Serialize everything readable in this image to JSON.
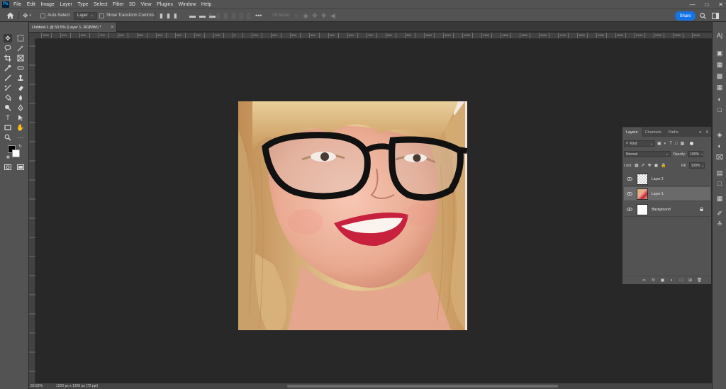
{
  "app": {
    "logo_text": "Ps"
  },
  "menu": [
    "File",
    "Edit",
    "Image",
    "Layer",
    "Type",
    "Select",
    "Filter",
    "3D",
    "View",
    "Plugins",
    "Window",
    "Help"
  ],
  "options_bar": {
    "auto_select_label": "Auto-Select:",
    "auto_select_value": "Layer",
    "transform_label": "Show Transform Controls",
    "mode_3d_label": "3D Mode:",
    "share_label": "Share"
  },
  "document_tab": {
    "title": "Untitled-1 @ 50.5% (Layer 1, RGB/8#) *",
    "close": "×"
  },
  "ruler": {
    "top_labels": [
      "1000",
      "950",
      "900",
      "850",
      "800",
      "750",
      "700",
      "650",
      "600",
      "550",
      "500",
      "450",
      "400",
      "350",
      "300",
      "250",
      "200",
      "150",
      "100",
      "50",
      "0",
      "50",
      "100",
      "150",
      "200",
      "250",
      "300",
      "350",
      "400",
      "450",
      "500",
      "550",
      "600",
      "650",
      "700",
      "750",
      "800",
      "850",
      "900",
      "950",
      "1000",
      "1050",
      "1100",
      "1150",
      "1200",
      "1250",
      "1300",
      "1350",
      "1400",
      "1450",
      "1500",
      "1550",
      "1600",
      "1650",
      "1700",
      "1750",
      "1800",
      "1850",
      "1900",
      "1950",
      "2000",
      "2050",
      "2100",
      "2150",
      "2200",
      "2250",
      "2300",
      "2350",
      "2400"
    ]
  },
  "status": {
    "zoom": "50.52%",
    "info": "1200 px x 1200 px (72 ppi)"
  },
  "layers_panel": {
    "tabs": [
      "Layers",
      "Channels",
      "Paths"
    ],
    "filter_kind": "Kind",
    "blend_mode": "Normal",
    "opacity_label": "Opacity:",
    "opacity_value": "100%",
    "lock_label": "Lock:",
    "fill_label": "Fill:",
    "fill_value": "100%",
    "layers": [
      {
        "name": "Layer 2",
        "thumb": "transparent",
        "selected": false
      },
      {
        "name": "Layer 1",
        "thumb": "photo",
        "selected": true
      },
      {
        "name": "Background",
        "thumb": "white",
        "selected": false,
        "locked": true
      }
    ]
  },
  "colors": {
    "ui_bg": "#535353",
    "canvas_bg": "#282828",
    "accent": "#1473e6",
    "selected_layer": "#6a6a6a"
  }
}
